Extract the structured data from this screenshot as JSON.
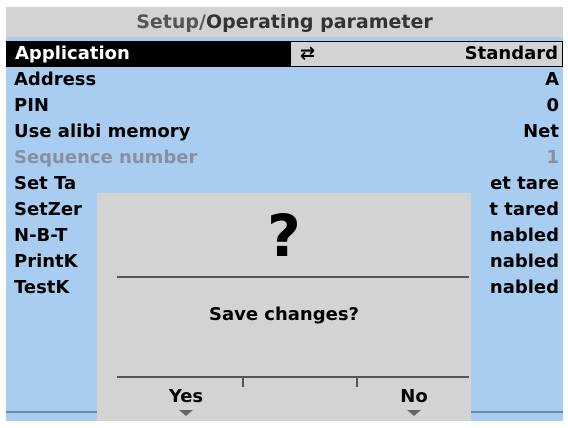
{
  "header": {
    "breadcrumb_parent": "Setup",
    "breadcrumb_sep": "/",
    "breadcrumb_current": "Operating parameter"
  },
  "params": [
    {
      "label": "Application",
      "value": "Standard",
      "selected": true,
      "icon": "toggle-arrows-icon"
    },
    {
      "label": "Address",
      "value": "A"
    },
    {
      "label": "PIN",
      "value": "0"
    },
    {
      "label": "Use alibi memory",
      "value": "Net"
    },
    {
      "label": "Sequence number",
      "value": "1",
      "disabled": true
    },
    {
      "label": "Set Ta",
      "value": "et tare"
    },
    {
      "label": "SetZer",
      "value": "t tared"
    },
    {
      "label": "N-B-T",
      "value": "nabled"
    },
    {
      "label": "PrintK",
      "value": "nabled"
    },
    {
      "label": "TestK",
      "value": "nabled"
    }
  ],
  "dialog": {
    "icon_glyph": "?",
    "message": "Save changes?",
    "yes_label": "Yes",
    "no_label": "No"
  },
  "colors": {
    "screen_bg": "#a9cdf0",
    "panel_gray": "#d3d3d3",
    "selected_label_bg": "#000000",
    "disabled_text": "#8a8fa0"
  },
  "icons": {
    "toggle": "⇄"
  }
}
